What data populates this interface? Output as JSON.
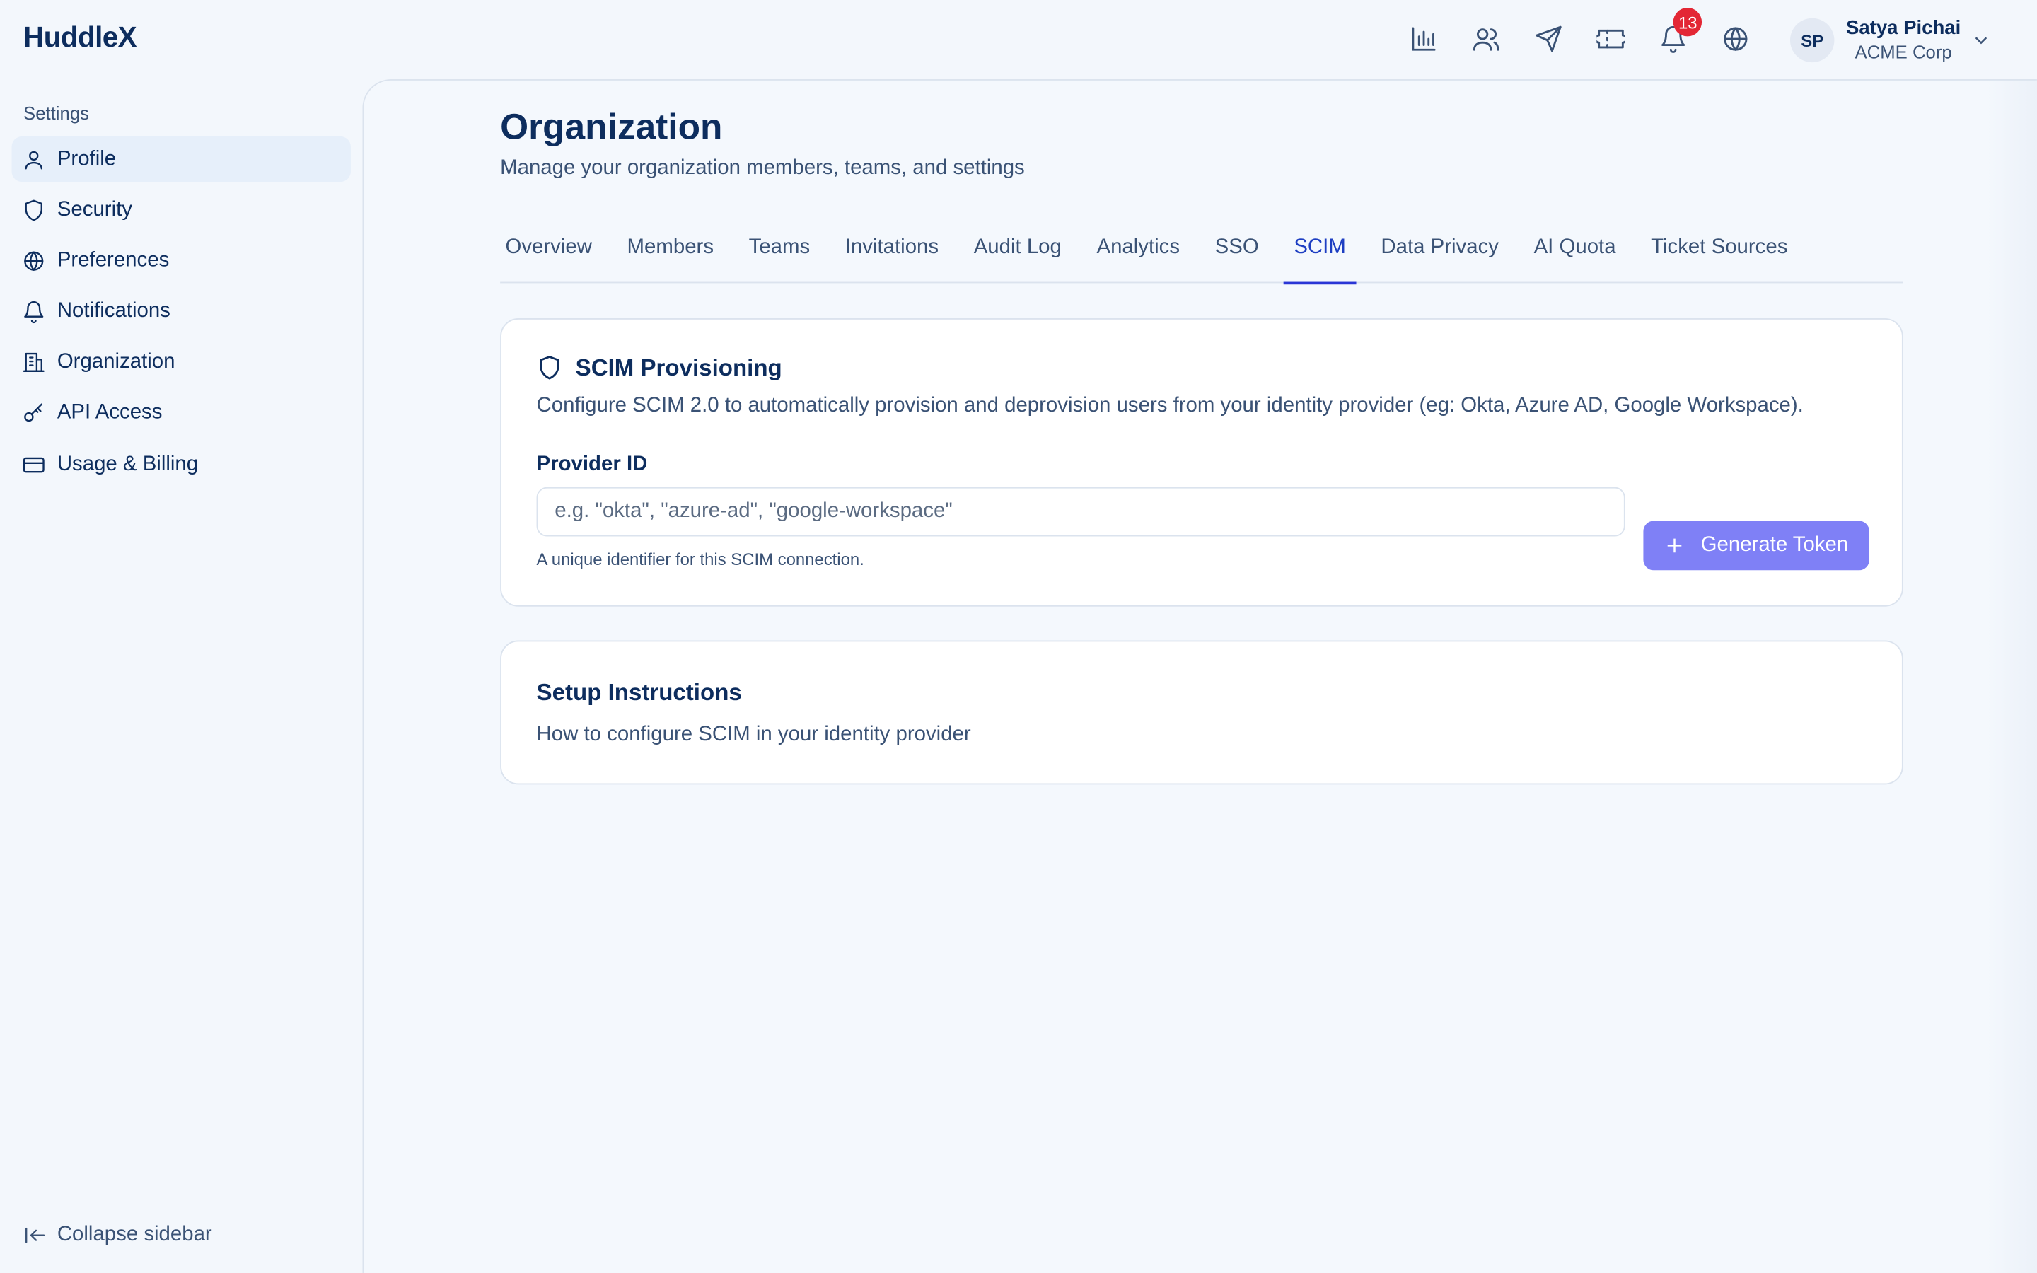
{
  "app": {
    "logo": "HuddleX"
  },
  "header": {
    "icons": [
      "analytics-icon",
      "users-icon",
      "send-icon",
      "ticket-icon",
      "bell-icon",
      "globe-icon"
    ],
    "notification_count": "13",
    "user": {
      "initials": "SP",
      "name": "Satya Pichai",
      "org": "ACME Corp"
    }
  },
  "sidebar": {
    "section_label": "Settings",
    "items": [
      {
        "label": "Profile",
        "icon": "user-icon",
        "active": true
      },
      {
        "label": "Security",
        "icon": "shield-icon"
      },
      {
        "label": "Preferences",
        "icon": "globe-icon"
      },
      {
        "label": "Notifications",
        "icon": "bell-icon"
      },
      {
        "label": "Organization",
        "icon": "building-icon"
      },
      {
        "label": "API Access",
        "icon": "key-icon"
      },
      {
        "label": "Usage & Billing",
        "icon": "credit-card-icon"
      }
    ],
    "collapse_label": "Collapse sidebar"
  },
  "main": {
    "title": "Organization",
    "subtitle": "Manage your organization members, teams, and settings",
    "tabs": [
      {
        "label": "Overview"
      },
      {
        "label": "Members"
      },
      {
        "label": "Teams"
      },
      {
        "label": "Invitations"
      },
      {
        "label": "Audit Log"
      },
      {
        "label": "Analytics"
      },
      {
        "label": "SSO"
      },
      {
        "label": "SCIM",
        "active": true
      },
      {
        "label": "Data Privacy"
      },
      {
        "label": "AI Quota"
      },
      {
        "label": "Ticket Sources"
      }
    ],
    "scim_card": {
      "title": "SCIM Provisioning",
      "description": "Configure SCIM 2.0 to automatically provision and deprovision users from your identity provider (eg: Okta, Azure AD, Google Workspace).",
      "field_label": "Provider ID",
      "field_value": "",
      "field_placeholder": "e.g. \"okta\", \"azure-ad\", \"google-workspace\"",
      "field_help": "A unique identifier for this SCIM connection.",
      "button_label": "Generate Token"
    },
    "setup_card": {
      "title": "Setup Instructions",
      "description": "How to configure SCIM in your identity provider"
    }
  },
  "colors": {
    "accent": "#2a36d6",
    "button": "#7f80f6",
    "badge": "#e32735",
    "text_primary": "#0d2d5e",
    "text_secondary": "#3a5275"
  }
}
